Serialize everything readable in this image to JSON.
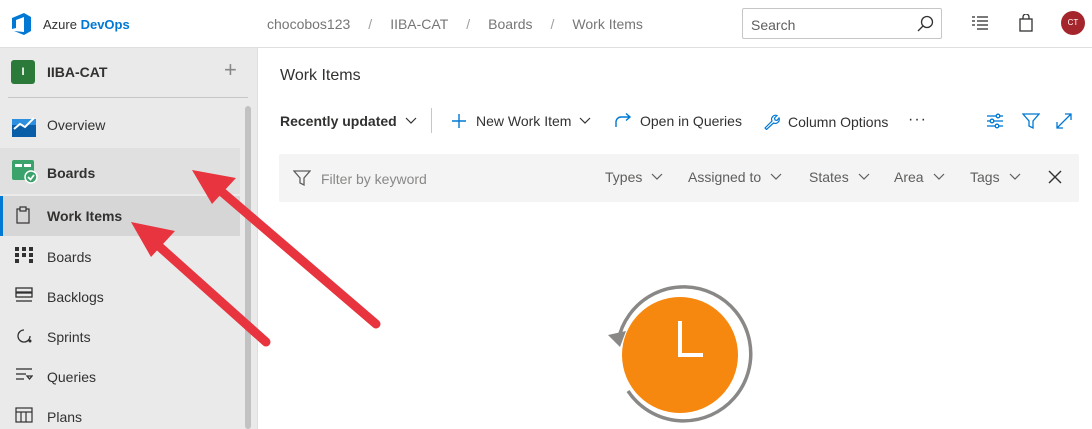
{
  "app": {
    "brand_prefix": "Azure ",
    "brand_name": "DevOps"
  },
  "breadcrumb": [
    "chocobos123",
    "IIBA-CAT",
    "Boards",
    "Work Items"
  ],
  "search": {
    "placeholder": "Search"
  },
  "user": {
    "initials": "CT",
    "color": "#a4262c"
  },
  "project": {
    "badge": "I",
    "name": "IIBA-CAT"
  },
  "sidebar": {
    "items": [
      {
        "label": "Overview"
      },
      {
        "label": "Boards"
      },
      {
        "label": "Work Items"
      },
      {
        "label": "Boards"
      },
      {
        "label": "Backlogs"
      },
      {
        "label": "Sprints"
      },
      {
        "label": "Queries"
      },
      {
        "label": "Plans"
      }
    ]
  },
  "main": {
    "title": "Work Items",
    "toolbar": {
      "view": "Recently updated",
      "new_item": "New Work Item",
      "open_queries": "Open in Queries",
      "column_options": "Column Options",
      "more": "···"
    },
    "filter": {
      "placeholder": "Filter by keyword",
      "dropdowns": [
        "Types",
        "Assigned to",
        "States",
        "Area",
        "Tags"
      ]
    }
  },
  "colors": {
    "accent": "#0078d4",
    "annotation_arrow": "#e8343e",
    "clock": "#f7880f"
  }
}
